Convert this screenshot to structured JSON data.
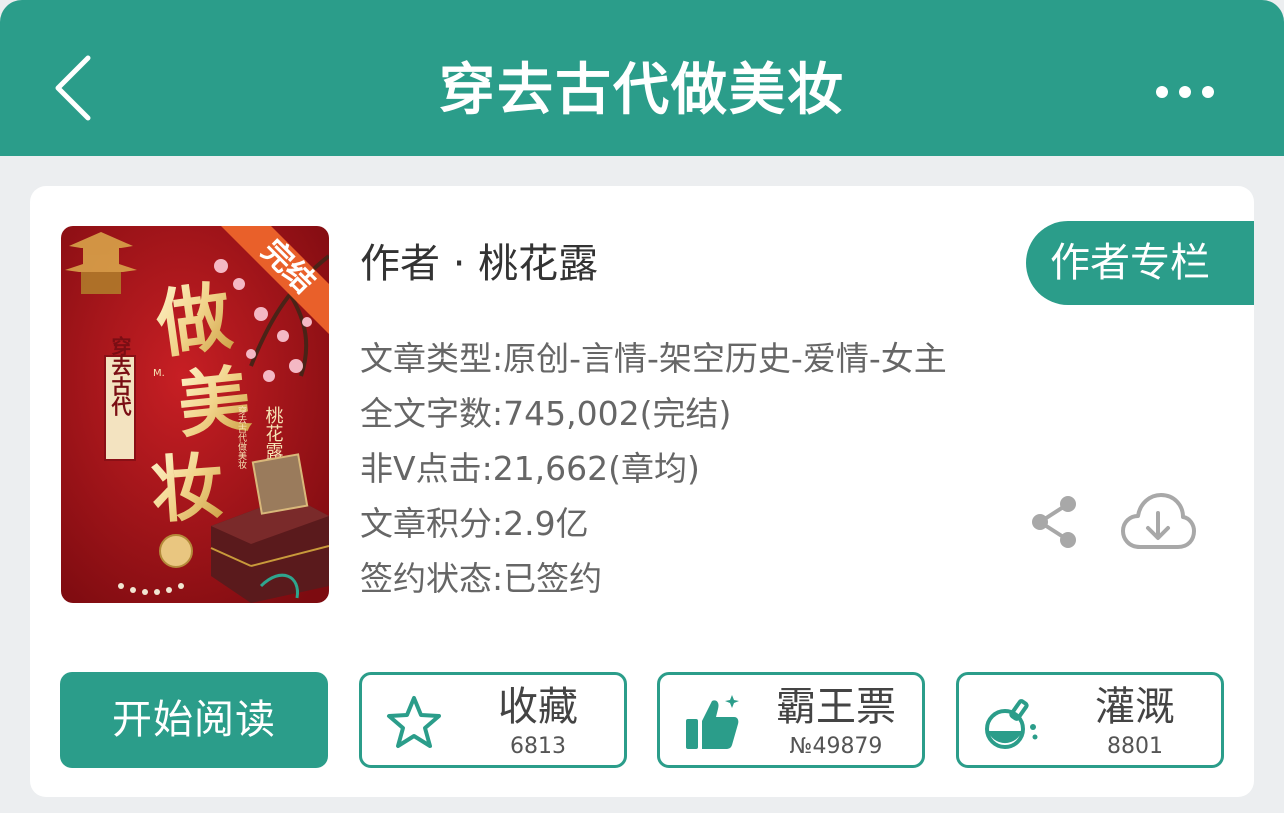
{
  "header": {
    "title": "穿去古代做美妆"
  },
  "cover": {
    "badge": "完结",
    "title_big_1": "做",
    "title_big_2": "美",
    "title_big_3": "妆",
    "subtitle": "穿去古代",
    "author_vertical": "桃花露",
    "m_label": "M.",
    "small_vertical": "穿去古代做美妆"
  },
  "book": {
    "author_line": "作者 · 桃花露",
    "author_column_label": "作者专栏",
    "type": "文章类型:原创-言情-架空历史-爱情-女主",
    "word_count": "全文字数:745,002(完结)",
    "clicks": "非V点击:21,662(章均)",
    "score": "文章积分:2.9亿",
    "sign_status": "签约状态:已签约"
  },
  "actions": {
    "read_label": "开始阅读",
    "favorite": {
      "label": "收藏",
      "count": "6813"
    },
    "vote": {
      "label": "霸王票",
      "count": "№49879"
    },
    "nutrient": {
      "label": "灌溉",
      "count": "8801"
    }
  },
  "colors": {
    "brand": "#2b9d8a",
    "cover_red": "#b3151d",
    "badge_orange": "#e9602a"
  },
  "icons": {
    "back": "chevron-left-icon",
    "more": "more-dots-icon",
    "share": "share-icon",
    "download": "cloud-download-icon",
    "favorite": "star-icon",
    "vote": "thumbs-up-icon",
    "nutrient": "flask-icon"
  }
}
